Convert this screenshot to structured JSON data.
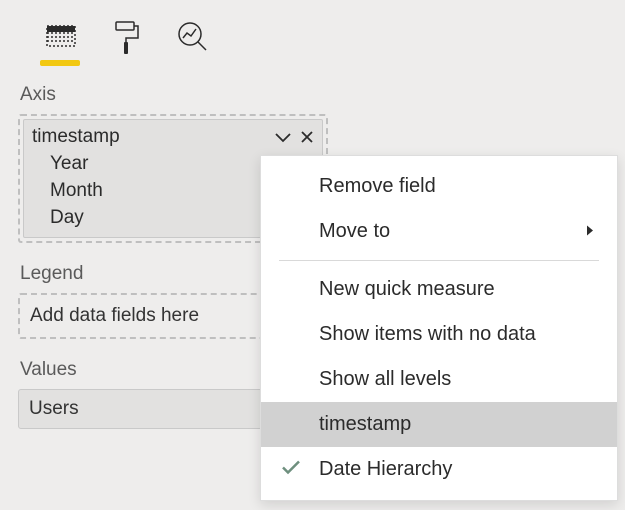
{
  "tabs": {
    "fields_selected": true
  },
  "sections": {
    "axis": {
      "label": "Axis",
      "field": {
        "name": "timestamp",
        "hierarchy": [
          "Year",
          "Month",
          "Day"
        ]
      }
    },
    "legend": {
      "label": "Legend",
      "placeholder": "Add data fields here"
    },
    "values": {
      "label": "Values",
      "field": "Users"
    }
  },
  "context_menu": {
    "remove_field": "Remove field",
    "move_to": "Move to",
    "new_quick_measure": "New quick measure",
    "show_items_no_data": "Show items with no data",
    "show_all_levels": "Show all levels",
    "timestamp": "timestamp",
    "date_hierarchy": "Date Hierarchy",
    "highlighted": "timestamp",
    "checked": "date_hierarchy"
  }
}
